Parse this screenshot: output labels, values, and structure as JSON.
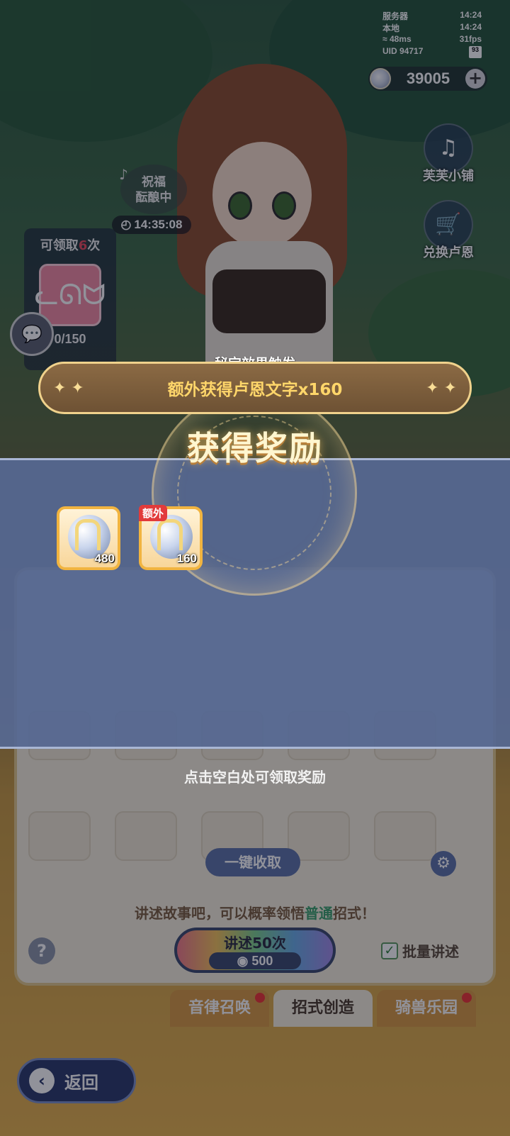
{
  "status_bar": {
    "server_label": "服务器",
    "server_time": "14:24",
    "local_label": "本地",
    "local_time": "14:24",
    "ping": "48ms",
    "fps": "31fps",
    "uid": "UID 94717",
    "battery": "93"
  },
  "currency": {
    "amount": "39005",
    "plus": "+"
  },
  "side_buttons": [
    {
      "label": "芙芙小铺",
      "icon": "harp-shop-icon"
    },
    {
      "label": "兑换卢恩",
      "icon": "cat-exchange-icon"
    }
  ],
  "blessing": {
    "label": "祝福\n酝酿中",
    "timer": "14:35:08"
  },
  "claim_panel": {
    "title_prefix": "可领取",
    "title_count": "6",
    "title_suffix": "次",
    "progress": "0/150"
  },
  "bottom_panel": {
    "one_key_collect": "一键收取",
    "hint_prefix": "讲述故事吧，可以概率领悟",
    "hint_highlight": "普通",
    "hint_suffix": "招式！",
    "help": "?",
    "tell_button": "讲述50次",
    "tell_cost": "500",
    "batch_label": "批量讲述",
    "batch_checked": true
  },
  "tabs": [
    {
      "label": "音律召唤",
      "active": false,
      "badge": true
    },
    {
      "label": "招式创造",
      "active": true,
      "badge": false
    },
    {
      "label": "骑兽乐园",
      "active": false,
      "badge": true
    }
  ],
  "back_button": "返回",
  "reward_popup": {
    "treasure_title": "秘宝效果触发",
    "treasure_text": "额外获得卢恩文字x160",
    "title": "获得奖励",
    "items": [
      {
        "quantity": "480",
        "tag": ""
      },
      {
        "quantity": "160",
        "tag": "额外"
      }
    ],
    "tap_hint": "点击空白处可领取奖励"
  },
  "colors": {
    "highlight_gold": "#ffd66a",
    "accent_red": "#e94a5b",
    "band": "#5668a0"
  }
}
